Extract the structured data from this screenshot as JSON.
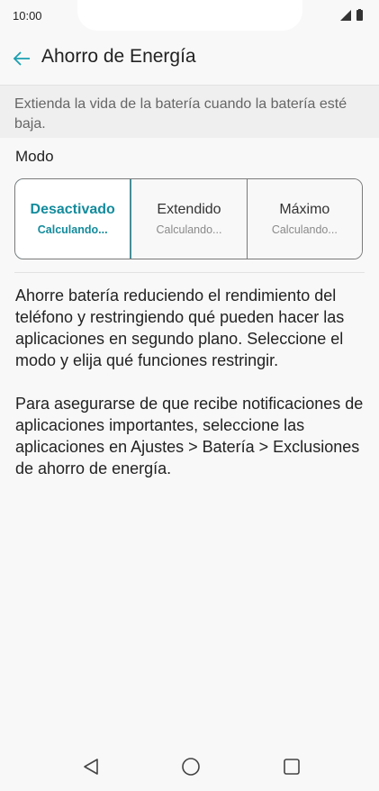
{
  "status_bar": {
    "time": "10:00",
    "icons": [
      "signal-icon",
      "battery-icon"
    ]
  },
  "app_bar": {
    "back_icon": "arrow-left-icon",
    "title": "Ahorro de Energía"
  },
  "description": "Extienda la vida de la batería cuando la batería esté baja.",
  "mode": {
    "label": "Modo",
    "options": [
      {
        "title": "Desactivado",
        "subtitle": "Calculando...",
        "selected": true
      },
      {
        "title": "Extendido",
        "subtitle": "Calculando...",
        "selected": false
      },
      {
        "title": "Máximo",
        "subtitle": "Calculando...",
        "selected": false
      }
    ]
  },
  "info": {
    "paragraph1": "Ahorre batería reduciendo el rendimiento del teléfono y restringiendo qué pueden hacer las aplicaciones en segundo plano. Seleccione el modo y elija qué funciones restringir.",
    "paragraph2": "Para asegurarse de que recibe notificaciones de aplicaciones importantes, seleccione las aplicaciones en Ajustes > Batería > Exclusiones de ahorro de energía."
  },
  "nav_bar": {
    "buttons": [
      "back-triangle-icon",
      "home-circle-icon",
      "recents-square-icon"
    ]
  },
  "colors": {
    "accent": "#138b9c",
    "background": "#f8f8f8"
  }
}
